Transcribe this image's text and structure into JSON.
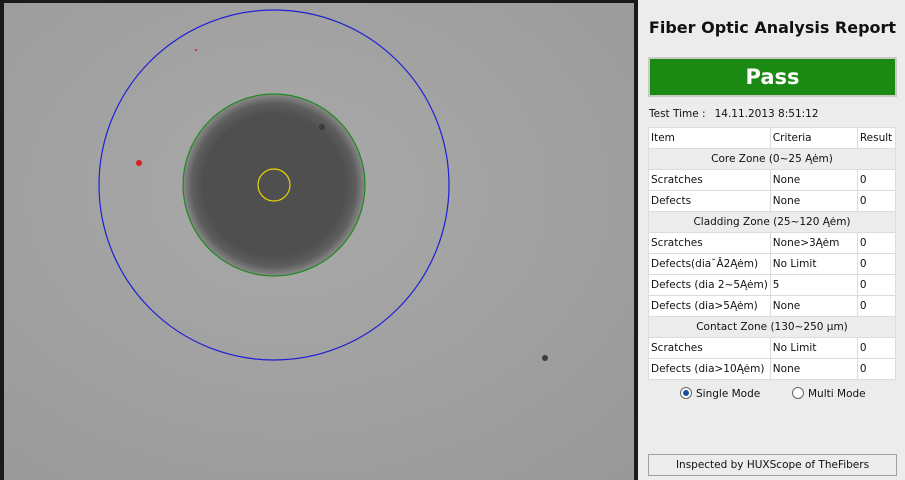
{
  "report": {
    "title": "Fiber Optic Analysis Report",
    "status": "Pass",
    "status_color": "#1a8a12",
    "test_time_label": "Test Time :",
    "test_time_value": "14.11.2013 8:51:12"
  },
  "table": {
    "headers": [
      "Item",
      "Criteria",
      "Result"
    ],
    "zones": [
      {
        "zone": "Core Zone (0~25 Ąėm)",
        "rows": [
          [
            "Scratches",
            "None",
            "0"
          ],
          [
            "Defects",
            "None",
            "0"
          ]
        ]
      },
      {
        "zone": "Cladding Zone (25~120 Ąėm)",
        "rows": [
          [
            "Scratches",
            "None>3Ąėm",
            "0"
          ],
          [
            "Defects(dia˘Â2Ąėm)",
            "No Limit",
            "0"
          ],
          [
            "Defects (dia 2~5Ąėm)",
            "5",
            "0"
          ],
          [
            "Defects (dia>5Ąėm)",
            "None",
            "0"
          ]
        ]
      },
      {
        "zone": "Contact Zone (130~250 µm)",
        "rows": [
          [
            "Scratches",
            "No Limit",
            "0"
          ],
          [
            "Defects (dia>10Ąėm)",
            "None",
            "0"
          ]
        ]
      }
    ]
  },
  "modes": {
    "single_label": "Single Mode",
    "multi_label": "Multi Mode",
    "selected": "Single Mode"
  },
  "footer": {
    "text": "Inspected by HUXScope of TheFibers"
  },
  "overlay_colors": {
    "contact_zone": "#1f1fd6",
    "cladding_zone": "#1e8a1e",
    "core_zone": "#e6d400",
    "defect": "#d81e1e"
  }
}
